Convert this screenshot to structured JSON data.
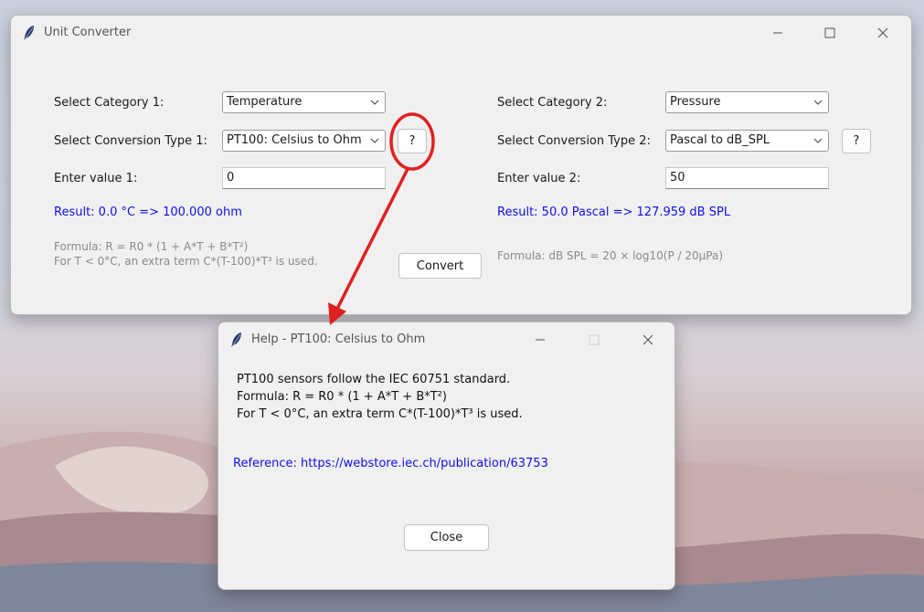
{
  "main_window": {
    "title": "Unit Converter",
    "category1_label": "Select Category 1:",
    "category1_value": "Temperature",
    "conv_type1_label": "Select Conversion Type 1:",
    "conv_type1_value": "PT100: Celsius to Ohm",
    "help1_label": "?",
    "value1_label": "Enter value 1:",
    "value1": "0",
    "result1": "Result: 0.0 °C => 100.000 ohm",
    "formula1_line1": "Formula: R = R0 * (1 + A*T + B*T²)",
    "formula1_line2": "For T < 0°C, an extra term C*(T-100)*T³ is used.",
    "convert_label": "Convert",
    "category2_label": "Select Category 2:",
    "category2_value": "Pressure",
    "conv_type2_label": "Select Conversion Type 2:",
    "conv_type2_value": "Pascal to dB_SPL",
    "help2_label": "?",
    "value2_label": "Enter value 2:",
    "value2": "50",
    "result2": "Result: 50.0 Pascal => 127.959 dB SPL",
    "formula2": "Formula: dB SPL = 20 × log10(P / 20μPa)"
  },
  "help_window": {
    "title": "Help - PT100: Celsius to Ohm",
    "line1": "PT100 sensors follow the IEC 60751 standard.",
    "line2": "Formula: R = R0 * (1 + A*T + B*T²)",
    "line3": "For T < 0°C, an extra term C*(T-100)*T³ is used.",
    "reference": "Reference: https://webstore.iec.ch/publication/63753",
    "close_label": "Close"
  },
  "colors": {
    "result": "#1010e0",
    "annotation": "#e02020",
    "window_bg": "#f0f0f0"
  }
}
